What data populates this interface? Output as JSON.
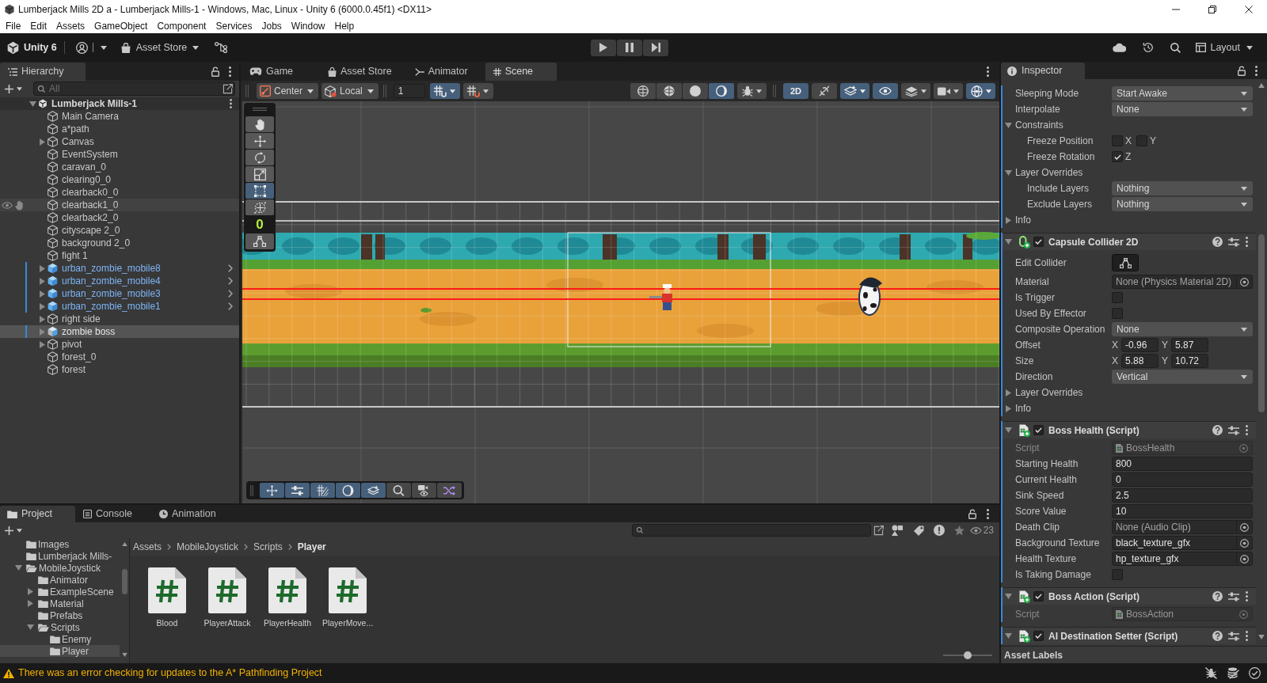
{
  "window": {
    "title": "Lumberjack Mills 2D a - Lumberjack Mills-1 - Windows, Mac, Linux - Unity 6 (6000.0.45f1) <DX11>"
  },
  "menu_bar": [
    "File",
    "Edit",
    "Assets",
    "GameObject",
    "Component",
    "Services",
    "Jobs",
    "Window",
    "Help"
  ],
  "toolbar": {
    "product": "Unity 6",
    "store_button": "Asset Store",
    "layout_button": "Layout"
  },
  "hierarchy": {
    "title": "Hierarchy",
    "search": {
      "placeholder": "All"
    },
    "scene": {
      "name": "Lumberjack Mills-1",
      "expanded": true,
      "children": [
        {
          "name": "Main Camera",
          "kind": "object",
          "expandable": false,
          "overrides": false,
          "selected": false,
          "hovered": false
        },
        {
          "name": "a*path",
          "kind": "object",
          "expandable": false,
          "overrides": false,
          "selected": false,
          "hovered": false
        },
        {
          "name": "Canvas",
          "kind": "object",
          "expandable": true,
          "overrides": false,
          "selected": false,
          "hovered": false
        },
        {
          "name": "EventSystem",
          "kind": "object",
          "expandable": false,
          "overrides": false,
          "selected": false,
          "hovered": false
        },
        {
          "name": "caravan_0",
          "kind": "object",
          "expandable": false,
          "overrides": false,
          "selected": false,
          "hovered": false
        },
        {
          "name": "clearing0_0",
          "kind": "object",
          "expandable": false,
          "overrides": false,
          "selected": false,
          "hovered": false
        },
        {
          "name": "clearback0_0",
          "kind": "object",
          "expandable": false,
          "overrides": false,
          "selected": false,
          "hovered": false
        },
        {
          "name": "clearback1_0",
          "kind": "object",
          "expandable": false,
          "overrides": false,
          "selected": false,
          "hovered": true
        },
        {
          "name": "clearback2_0",
          "kind": "object",
          "expandable": false,
          "overrides": false,
          "selected": false,
          "hovered": false
        },
        {
          "name": "cityscape 2_0",
          "kind": "object",
          "expandable": false,
          "overrides": false,
          "selected": false,
          "hovered": false
        },
        {
          "name": "background 2_0",
          "kind": "object",
          "expandable": false,
          "overrides": false,
          "selected": false,
          "hovered": false
        },
        {
          "name": "fight 1",
          "kind": "object",
          "expandable": false,
          "overrides": false,
          "selected": false,
          "hovered": false
        },
        {
          "name": "urban_zombie_mobile8",
          "kind": "prefab",
          "expandable": true,
          "overrides": true,
          "selected": false,
          "hovered": false
        },
        {
          "name": "urban_zombie_mobile4",
          "kind": "prefab",
          "expandable": true,
          "overrides": true,
          "selected": false,
          "hovered": false
        },
        {
          "name": "urban_zombie_mobile3",
          "kind": "prefab",
          "expandable": true,
          "overrides": true,
          "selected": false,
          "hovered": false
        },
        {
          "name": "urban_zombie_mobile1",
          "kind": "prefab",
          "expandable": true,
          "overrides": true,
          "selected": false,
          "hovered": false
        },
        {
          "name": "right side",
          "kind": "object",
          "expandable": true,
          "overrides": false,
          "selected": false,
          "hovered": false
        },
        {
          "name": "zombie boss",
          "kind": "prefab_variant",
          "expandable": true,
          "overrides": true,
          "selected": true,
          "hovered": false
        },
        {
          "name": "pivot",
          "kind": "object",
          "expandable": true,
          "overrides": false,
          "selected": false,
          "hovered": false
        },
        {
          "name": "forest_0",
          "kind": "object",
          "expandable": false,
          "overrides": false,
          "selected": false,
          "hovered": false
        },
        {
          "name": "forest",
          "kind": "object",
          "expandable": false,
          "overrides": false,
          "selected": false,
          "hovered": false
        }
      ]
    }
  },
  "scene_view": {
    "tabs": [
      {
        "label": "Game",
        "kind": "game",
        "selected": false
      },
      {
        "label": "Asset Store",
        "kind": "store",
        "selected": false
      },
      {
        "label": "Animator",
        "kind": "animator",
        "selected": false
      },
      {
        "label": "Scene",
        "kind": "scene",
        "selected": true
      }
    ],
    "pivot_mode": "Center",
    "pivot_rotation": "Local",
    "grid_increment": "1",
    "snap_toggles": [
      {
        "kind": "grid_snap",
        "on": true
      },
      {
        "kind": "grid_visibility",
        "on": false
      }
    ],
    "draw_modes": [
      {
        "kind": "wireframe",
        "selected": false
      },
      {
        "kind": "shaded_wireframe",
        "selected": false
      },
      {
        "kind": "shaded",
        "selected": false
      },
      {
        "kind": "unlit",
        "selected": true
      }
    ],
    "view_toggles": [
      {
        "kind": "debug",
        "on": false
      },
      {
        "kind": "two_d",
        "label": "2D",
        "on": true
      },
      {
        "kind": "lighting",
        "on": false
      },
      {
        "kind": "effects",
        "on": true
      },
      {
        "kind": "visibility",
        "on": true
      },
      {
        "kind": "layers",
        "on": false
      },
      {
        "kind": "camera",
        "on": false
      },
      {
        "kind": "gizmos",
        "on": true
      }
    ],
    "tools": [
      {
        "kind": "view",
        "selected": false
      },
      {
        "kind": "move",
        "selected": false
      },
      {
        "kind": "rotate",
        "selected": false
      },
      {
        "kind": "scale",
        "selected": false
      },
      {
        "kind": "rect",
        "selected": true
      },
      {
        "kind": "transform",
        "selected": false
      }
    ],
    "tool_counter": "0",
    "overlay_toggles": [
      {
        "kind": "move",
        "on": true
      },
      {
        "kind": "snapping",
        "on": true
      },
      {
        "kind": "grid",
        "on": true
      },
      {
        "kind": "shading",
        "on": true
      },
      {
        "kind": "layers",
        "on": true
      },
      {
        "kind": "search",
        "on": false
      },
      {
        "kind": "camera",
        "on": false
      },
      {
        "kind": "shuffle",
        "on": false
      }
    ]
  },
  "inspector": {
    "title": "Inspector",
    "components": [
      {
        "kind": "partial",
        "overridden": true,
        "rows": [
          {
            "kind": "dropdown",
            "label": "Sleeping Mode",
            "value": "Start Awake"
          },
          {
            "kind": "dropdown",
            "label": "Interpolate",
            "value": "None"
          },
          {
            "kind": "foldout",
            "label": "Constraints",
            "expanded": true,
            "children": [
              {
                "kind": "axis_toggles",
                "label": "Freeze Position",
                "axes": [
                  {
                    "label": "X",
                    "checked": false
                  },
                  {
                    "label": "Y",
                    "checked": false
                  }
                ]
              },
              {
                "kind": "axis_toggles",
                "label": "Freeze Rotation",
                "axes": [
                  {
                    "label": "Z",
                    "checked": true
                  }
                ]
              }
            ]
          },
          {
            "kind": "foldout",
            "label": "Layer Overrides",
            "expanded": true,
            "children": [
              {
                "kind": "dropdown",
                "label": "Include Layers",
                "value": "Nothing"
              },
              {
                "kind": "dropdown",
                "label": "Exclude Layers",
                "value": "Nothing"
              }
            ]
          },
          {
            "kind": "foldout",
            "label": "Info",
            "expanded": false
          }
        ]
      },
      {
        "kind": "collider",
        "title": "Capsule Collider 2D",
        "enabled": true,
        "expanded": true,
        "overridden": true,
        "rows": [
          {
            "kind": "button",
            "label": "Edit Collider"
          },
          {
            "kind": "object",
            "label": "Material",
            "value": "None (Physics Material 2D)",
            "assigned": false
          },
          {
            "kind": "checkbox",
            "label": "Is Trigger",
            "checked": false
          },
          {
            "kind": "checkbox",
            "label": "Used By Effector",
            "checked": false
          },
          {
            "kind": "dropdown",
            "label": "Composite Operation",
            "value": "None"
          },
          {
            "kind": "vector2",
            "label": "Offset",
            "fields": [
              {
                "axis": "X",
                "value": "-0.96"
              },
              {
                "axis": "Y",
                "value": "5.87"
              }
            ]
          },
          {
            "kind": "vector2",
            "label": "Size",
            "fields": [
              {
                "axis": "X",
                "value": "5.88"
              },
              {
                "axis": "Y",
                "value": "10.72"
              }
            ]
          },
          {
            "kind": "dropdown",
            "label": "Direction",
            "value": "Vertical"
          },
          {
            "kind": "foldout",
            "label": "Layer Overrides",
            "expanded": false
          },
          {
            "kind": "foldout",
            "label": "Info",
            "expanded": false
          }
        ]
      },
      {
        "kind": "script",
        "title": "Boss Health (Script)",
        "enabled": true,
        "expanded": true,
        "overridden": true,
        "rows": [
          {
            "kind": "script",
            "label": "Script",
            "value": "BossHealth",
            "disabled": true
          },
          {
            "kind": "number",
            "label": "Starting Health",
            "value": "800"
          },
          {
            "kind": "number",
            "label": "Current Health",
            "value": "0"
          },
          {
            "kind": "number",
            "label": "Sink Speed",
            "value": "2.5"
          },
          {
            "kind": "number",
            "label": "Score Value",
            "value": "10"
          },
          {
            "kind": "object",
            "label": "Death Clip",
            "value": "None (Audio Clip)",
            "assigned": false
          },
          {
            "kind": "object",
            "label": "Background Texture",
            "value": "black_texture_gfx",
            "assigned": true
          },
          {
            "kind": "object",
            "label": "Health Texture",
            "value": "hp_texture_gfx",
            "assigned": true
          },
          {
            "kind": "checkbox",
            "label": "Is Taking Damage",
            "checked": false
          }
        ]
      },
      {
        "kind": "script",
        "title": "Boss Action (Script)",
        "enabled": true,
        "expanded": true,
        "overridden": true,
        "rows": [
          {
            "kind": "script",
            "label": "Script",
            "value": "BossAction",
            "disabled": true
          }
        ]
      },
      {
        "kind": "script",
        "title": "AI Destination Setter (Script)",
        "enabled": true,
        "expanded": true,
        "overridden": true
      }
    ],
    "footer": "Asset Labels"
  },
  "project": {
    "tabs": [
      {
        "label": "Project",
        "kind": "project",
        "selected": true
      },
      {
        "label": "Console",
        "kind": "console",
        "selected": false
      },
      {
        "label": "Animation",
        "kind": "animation",
        "selected": false
      }
    ],
    "hidden_count": "23",
    "folders": [
      {
        "name": "Images",
        "expandable": false,
        "expanded": false,
        "selected": false
      },
      {
        "name": "Lumberjack Mills-",
        "expandable": false,
        "expanded": false,
        "selected": false
      },
      {
        "name": "MobileJoystick",
        "expandable": true,
        "expanded": true,
        "selected": false,
        "children": [
          {
            "name": "Animator",
            "expandable": false,
            "expanded": false,
            "selected": false
          },
          {
            "name": "ExampleScene",
            "expandable": true,
            "expanded": false,
            "selected": false
          },
          {
            "name": "Material",
            "expandable": true,
            "expanded": false,
            "selected": false
          },
          {
            "name": "Prefabs",
            "expandable": false,
            "expanded": false,
            "selected": false
          },
          {
            "name": "Scripts",
            "expandable": true,
            "expanded": true,
            "selected": false,
            "children": [
              {
                "name": "Enemy",
                "expandable": false,
                "expanded": false,
                "selected": false
              },
              {
                "name": "Player",
                "expandable": false,
                "expanded": false,
                "selected": true
              }
            ]
          }
        ]
      }
    ],
    "breadcrumb": [
      "Assets",
      "MobileJoystick",
      "Scripts",
      "Player"
    ],
    "assets": [
      {
        "name": "Blood",
        "kind": "script"
      },
      {
        "name": "PlayerAttack",
        "kind": "script"
      },
      {
        "name": "PlayerHealth",
        "kind": "script"
      },
      {
        "name": "PlayerMove...",
        "kind": "script"
      }
    ],
    "icon_size": {
      "level": 0.5
    }
  },
  "status_bar": {
    "kind": "warning",
    "message": "There was an error checking for updates to the A* Pathfinding Project"
  }
}
